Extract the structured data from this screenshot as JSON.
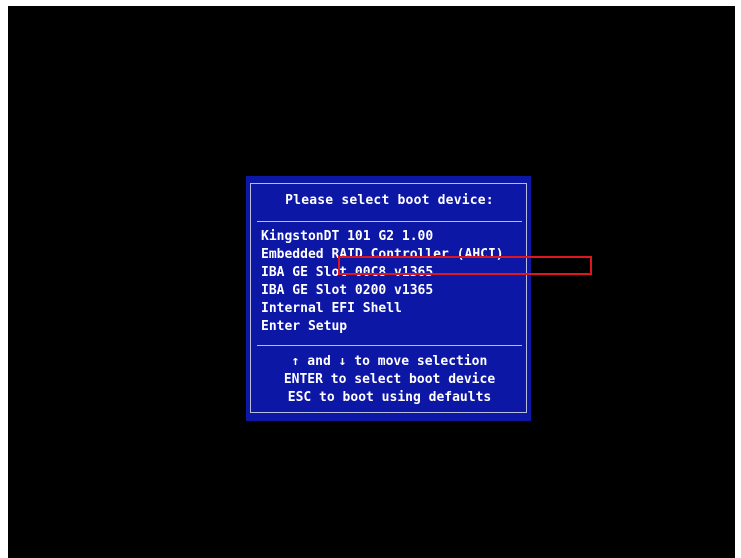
{
  "dialog": {
    "title": "Please select boot device:",
    "boot_devices": [
      "KingstonDT 101 G2 1.00",
      "Embedded RAID Controller (AHCI)",
      "IBA GE Slot 00C8 v1365",
      "IBA GE Slot 0200 v1365",
      "Internal EFI Shell",
      "Enter Setup"
    ],
    "help_lines": [
      "↑ and ↓ to move selection",
      "ENTER to select boot device",
      "ESC to boot using defaults"
    ]
  },
  "colors": {
    "screen_background": "#000000",
    "dialog_background": "#0d17a6",
    "dialog_border": "#b8bed9",
    "text": "#ffffff",
    "highlight_annotation": "#e0161e"
  }
}
